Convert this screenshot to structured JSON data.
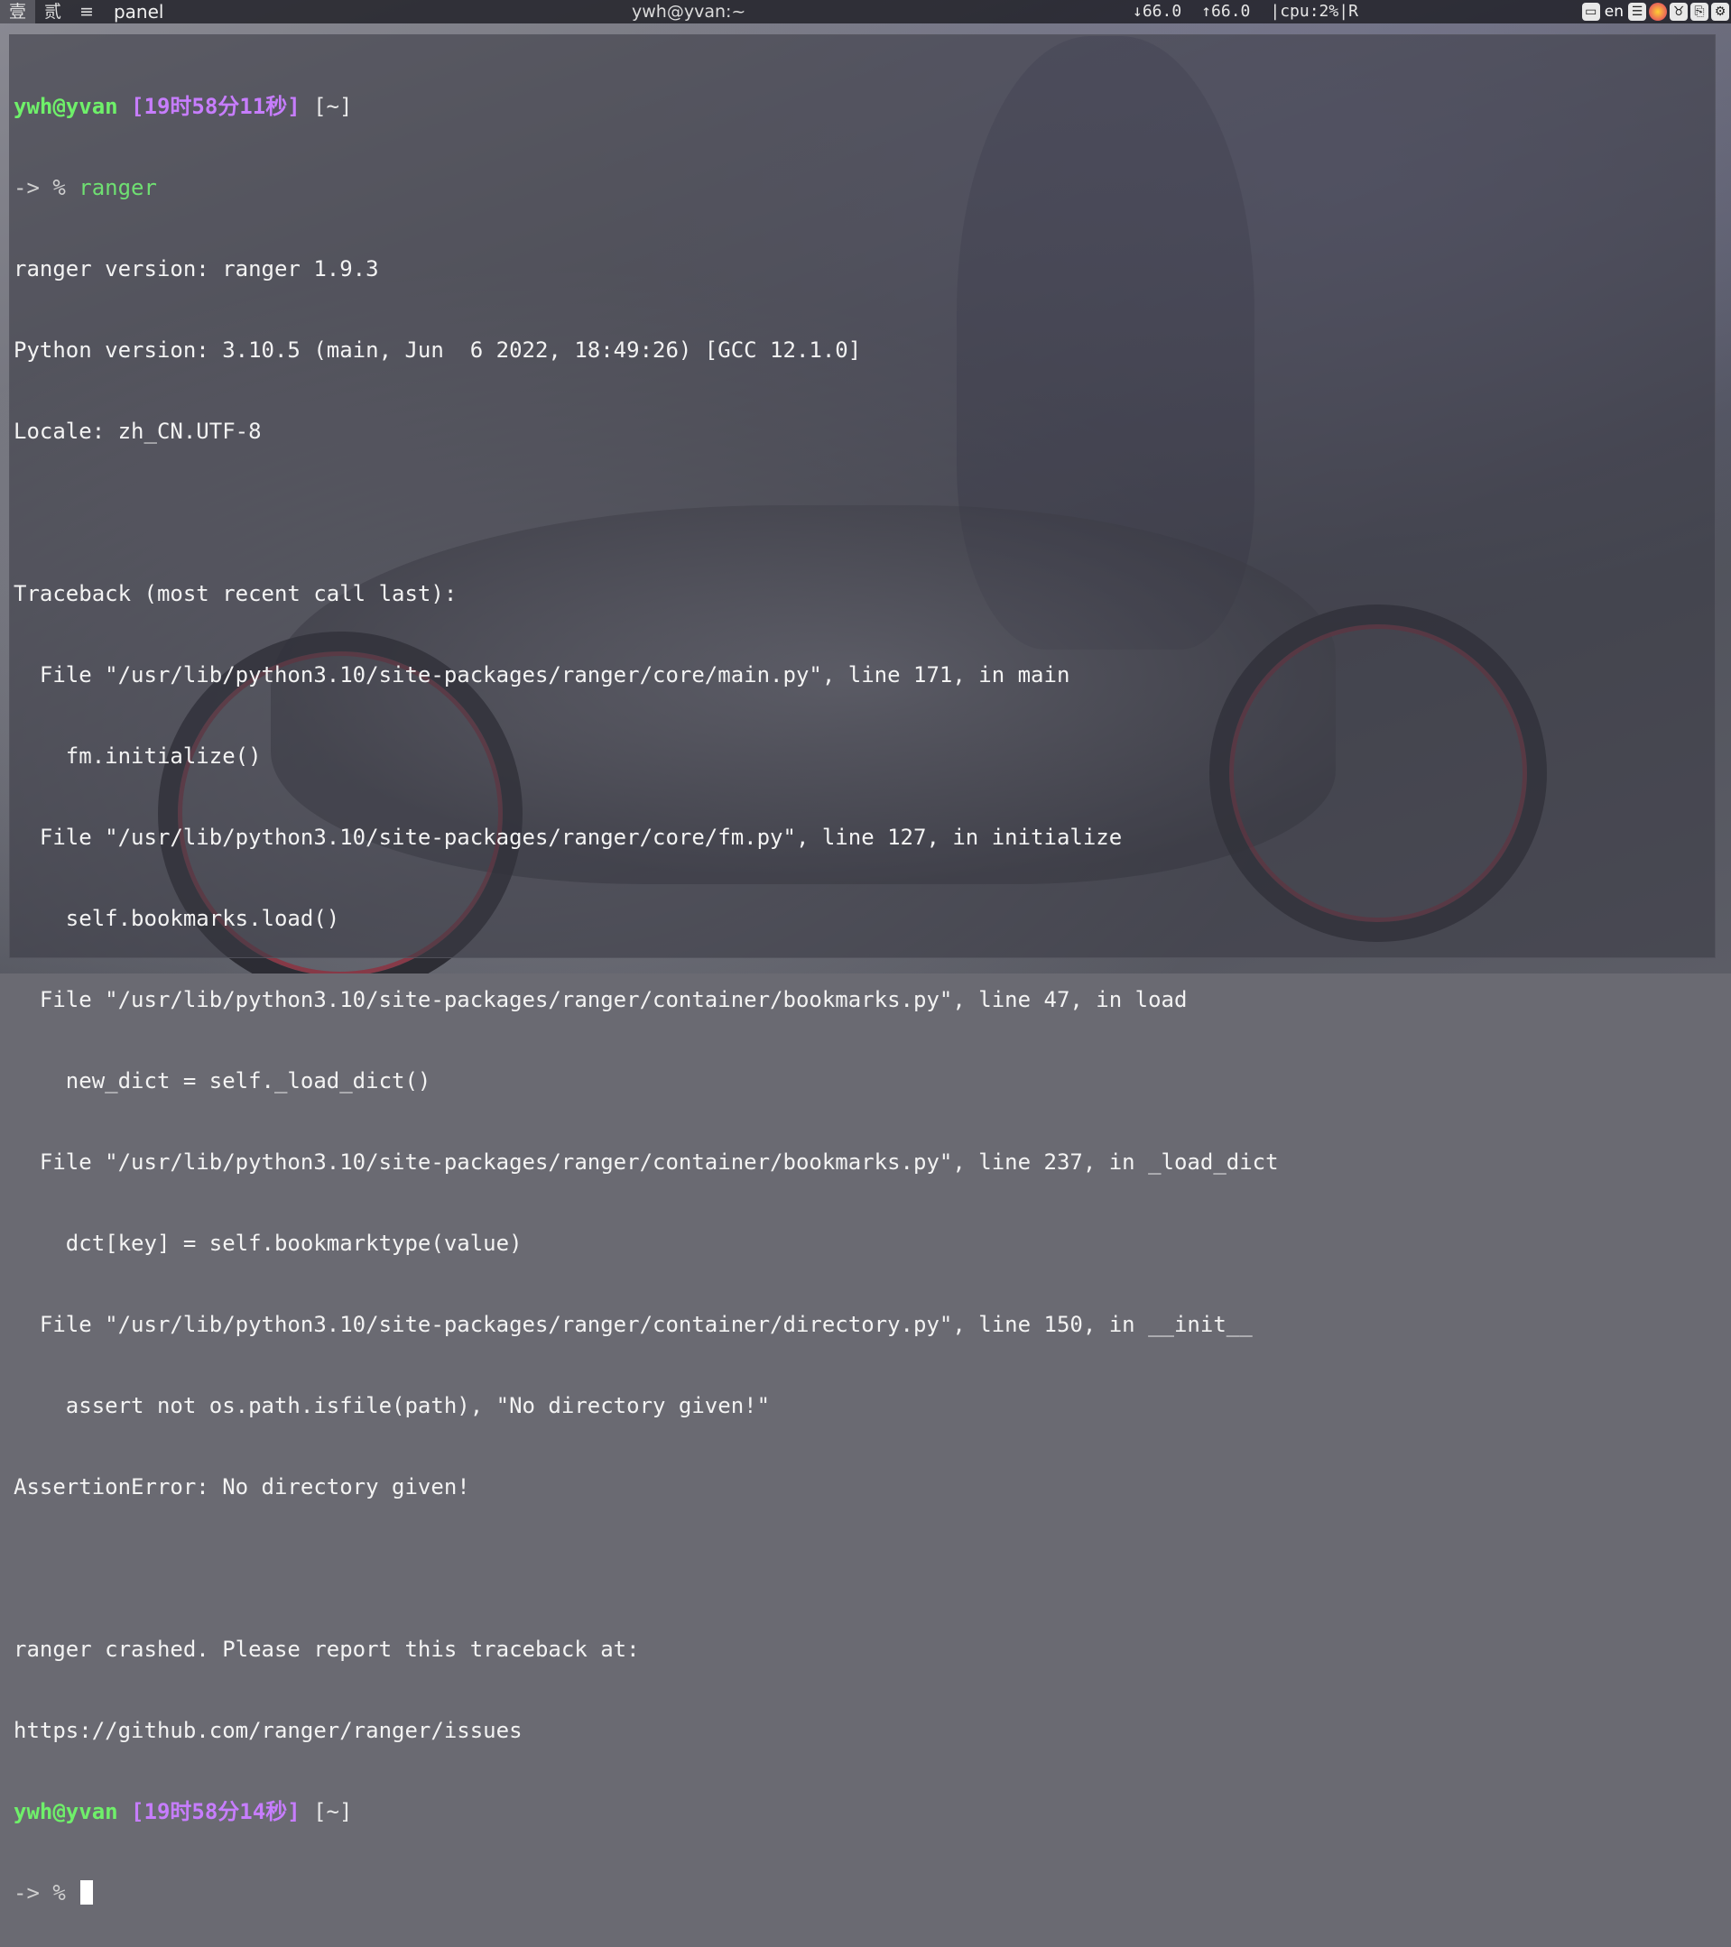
{
  "panel": {
    "workspaces": [
      "壹",
      "贰",
      "≡"
    ],
    "title": "panel",
    "window_title": "ywh@yvan:~",
    "net_down": "↓66.0",
    "net_up": "↑66.0",
    "cpu": "|cpu:2%|R",
    "lang": "en",
    "tray_icons": [
      "drive-icon",
      "menu-icon",
      "firefox-icon",
      "gadget-icon",
      "clipboard-icon",
      "settings-icon"
    ]
  },
  "terminal": {
    "prompt1": {
      "user": "ywh@yvan",
      "time": "[19时58分11秒]",
      "cwd": "[~]",
      "arrow": "-> %",
      "command": "ranger"
    },
    "output": [
      "ranger version: ranger 1.9.3",
      "Python version: 3.10.5 (main, Jun  6 2022, 18:49:26) [GCC 12.1.0]",
      "Locale: zh_CN.UTF-8",
      "",
      "Traceback (most recent call last):",
      "  File \"/usr/lib/python3.10/site-packages/ranger/core/main.py\", line 171, in main",
      "    fm.initialize()",
      "  File \"/usr/lib/python3.10/site-packages/ranger/core/fm.py\", line 127, in initialize",
      "    self.bookmarks.load()",
      "  File \"/usr/lib/python3.10/site-packages/ranger/container/bookmarks.py\", line 47, in load",
      "    new_dict = self._load_dict()",
      "  File \"/usr/lib/python3.10/site-packages/ranger/container/bookmarks.py\", line 237, in _load_dict",
      "    dct[key] = self.bookmarktype(value)",
      "  File \"/usr/lib/python3.10/site-packages/ranger/container/directory.py\", line 150, in __init__",
      "    assert not os.path.isfile(path), \"No directory given!\"",
      "AssertionError: No directory given!",
      "",
      "ranger crashed. Please report this traceback at:",
      "https://github.com/ranger/ranger/issues"
    ],
    "prompt2": {
      "user": "ywh@yvan",
      "time": "[19时58分14秒]",
      "cwd": "[~]",
      "arrow": "-> %"
    }
  }
}
